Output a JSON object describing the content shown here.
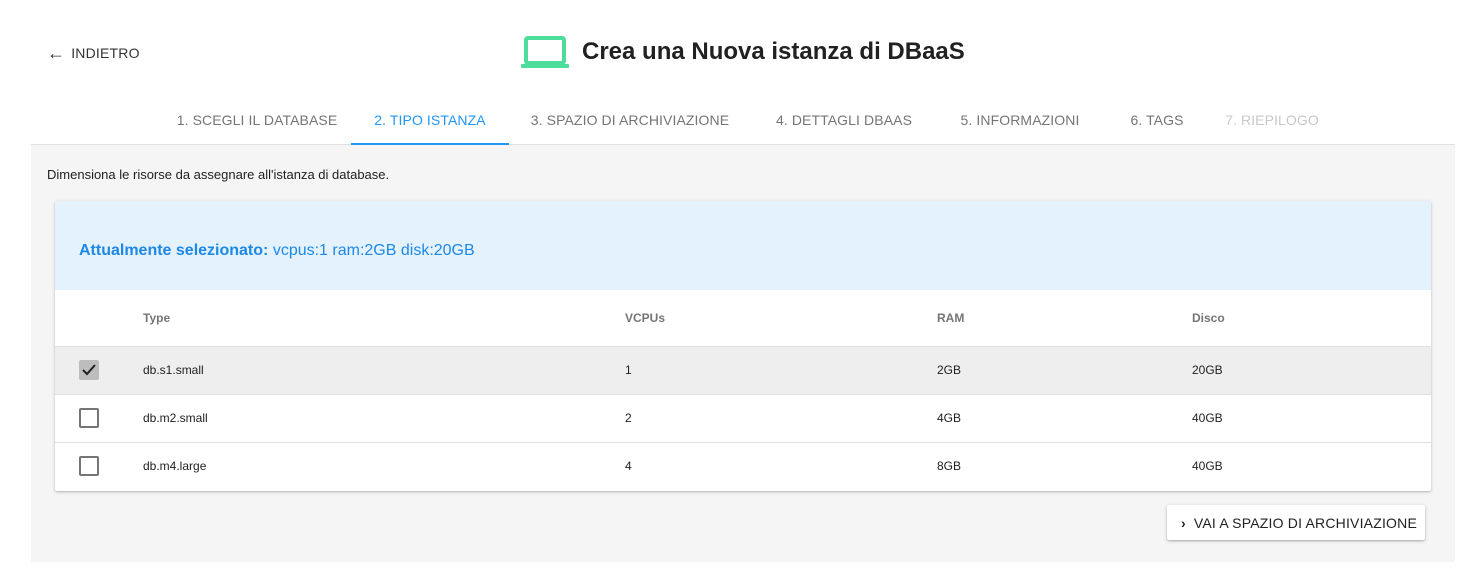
{
  "header": {
    "back_label": "INDIETRO",
    "title": "Crea una Nuova istanza di DBaaS",
    "title_icon": "laptop-icon",
    "accent_color": "#4cdd9a"
  },
  "tabs": [
    {
      "label": "1. SCEGLI IL DATABASE",
      "state": "normal"
    },
    {
      "label": "2. TIPO ISTANZA",
      "state": "active"
    },
    {
      "label": "3. SPAZIO DI ARCHIVIAZIONE",
      "state": "normal"
    },
    {
      "label": "4. DETTAGLI DBAAS",
      "state": "normal"
    },
    {
      "label": "5. INFORMAZIONI",
      "state": "normal"
    },
    {
      "label": "6. TAGS",
      "state": "normal"
    },
    {
      "label": "7. RIEPILOGO",
      "state": "disabled"
    }
  ],
  "main": {
    "description": "Dimensiona le risorse da assegnare all'istanza di database.",
    "selected_prefix": "Attualmente selezionato:",
    "selected_value": "vcpus:1 ram:2GB disk:20GB",
    "table": {
      "headers": [
        "Type",
        "VCPUs",
        "RAM",
        "Disco"
      ],
      "rows": [
        {
          "type": "db.s1.small",
          "vcpus": "1",
          "ram": "2GB",
          "disk": "20GB",
          "selected": true
        },
        {
          "type": "db.m2.small",
          "vcpus": "2",
          "ram": "4GB",
          "disk": "40GB",
          "selected": false
        },
        {
          "type": "db.m4.large",
          "vcpus": "4",
          "ram": "8GB",
          "disk": "40GB",
          "selected": false
        }
      ]
    },
    "next_button": "VAI A SPAZIO DI ARCHIVIAZIONE"
  },
  "colors": {
    "accent_blue": "#2196f3",
    "selected_bar_bg": "#e3f2fd"
  }
}
